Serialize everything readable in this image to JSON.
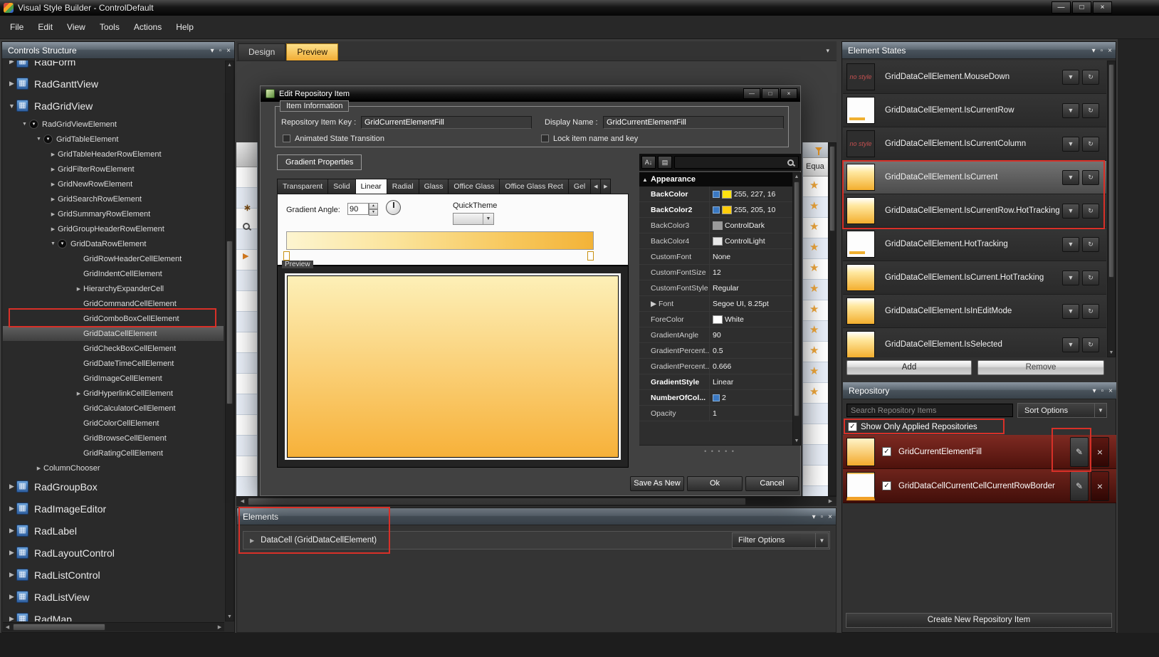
{
  "window": {
    "title": "Visual Style Builder - ControlDefault"
  },
  "menu": [
    "File",
    "Edit",
    "View",
    "Tools",
    "Actions",
    "Help"
  ],
  "controls_structure": {
    "title": "Controls Structure",
    "tree": [
      {
        "label": "RadForm",
        "level": 0,
        "top": true,
        "arrow": "right"
      },
      {
        "label": "RadGanttView",
        "level": 0,
        "top": true,
        "arrow": "right"
      },
      {
        "label": "RadGridView",
        "level": 0,
        "top": true,
        "arrow": "down"
      },
      {
        "label": "RadGridViewElement",
        "level": 1,
        "arrow": "down",
        "bullet": true
      },
      {
        "label": "GridTableElement",
        "level": 2,
        "arrow": "down",
        "bullet": true
      },
      {
        "label": "GridTableHeaderRowElement",
        "level": 3,
        "arrow": "right"
      },
      {
        "label": "GridFilterRowElement",
        "level": 3,
        "arrow": "right"
      },
      {
        "label": "GridNewRowElement",
        "level": 3,
        "arrow": "right"
      },
      {
        "label": "GridSearchRowElement",
        "level": 3,
        "arrow": "right"
      },
      {
        "label": "GridSummaryRowElement",
        "level": 3,
        "arrow": "right"
      },
      {
        "label": "GridGroupHeaderRowElement",
        "level": 3,
        "arrow": "right"
      },
      {
        "label": "GridDataRowElement",
        "level": 3,
        "arrow": "down",
        "bullet": true
      },
      {
        "label": "GridRowHeaderCellElement",
        "level": 4
      },
      {
        "label": "GridIndentCellElement",
        "level": 4
      },
      {
        "label": "HierarchyExpanderCell",
        "level": 4,
        "arrow": "right"
      },
      {
        "label": "GridCommandCellElement",
        "level": 4
      },
      {
        "label": "GridComboBoxCellElement",
        "level": 4
      },
      {
        "label": "GridDataCellElement",
        "level": 4,
        "selected": true
      },
      {
        "label": "GridCheckBoxCellElement",
        "level": 4
      },
      {
        "label": "GridDateTimeCellElement",
        "level": 4
      },
      {
        "label": "GridImageCellElement",
        "level": 4
      },
      {
        "label": "GridHyperlinkCellElement",
        "level": 4,
        "arrow": "right"
      },
      {
        "label": "GridCalculatorCellElement",
        "level": 4
      },
      {
        "label": "GridColorCellElement",
        "level": 4
      },
      {
        "label": "GridBrowseCellElement",
        "level": 4
      },
      {
        "label": "GridRatingCellElement",
        "level": 4
      },
      {
        "label": "ColumnChooser",
        "level": 2,
        "arrow": "right"
      },
      {
        "label": "RadGroupBox",
        "level": 0,
        "top": true,
        "arrow": "right"
      },
      {
        "label": "RadImageEditor",
        "level": 0,
        "top": true,
        "arrow": "right"
      },
      {
        "label": "RadLabel",
        "level": 0,
        "top": true,
        "arrow": "right"
      },
      {
        "label": "RadLayoutControl",
        "level": 0,
        "top": true,
        "arrow": "right"
      },
      {
        "label": "RadListControl",
        "level": 0,
        "top": true,
        "arrow": "right"
      },
      {
        "label": "RadListView",
        "level": 0,
        "top": true,
        "arrow": "right"
      },
      {
        "label": "RadMap",
        "level": 0,
        "top": true,
        "arrow": "right"
      }
    ]
  },
  "design_tabs": [
    {
      "label": "Design",
      "active": false
    },
    {
      "label": "Preview",
      "active": true
    }
  ],
  "dialog": {
    "title": "Edit Repository Item",
    "item_information": {
      "group_label": "Item Information",
      "repository_item_key_label": "Repository Item Key :",
      "repository_item_key_value": "GridCurrentElementFill",
      "display_name_label": "Display Name :",
      "display_name_value": "GridCurrentElementFill",
      "animated_checkbox_label": "Animated State Transition",
      "lock_checkbox_label": "Lock item name and key"
    },
    "gradient_tab_label": "Gradient Properties",
    "style_tabs": [
      "Transparent",
      "Solid",
      "Linear",
      "Radial",
      "Glass",
      "Office Glass",
      "Office Glass Rect",
      "Gel"
    ],
    "active_style_tab": "Linear",
    "gradient_angle_label": "Gradient Angle:",
    "gradient_angle_value": "90",
    "quick_theme_label": "QuickTheme",
    "preview_label": "Preview",
    "property_grid": {
      "category": "Appearance",
      "rows": [
        {
          "name": "BackColor",
          "value": "255, 227, 16",
          "swatch": "#ffe310",
          "bold": true,
          "marker": true
        },
        {
          "name": "BackColor2",
          "value": "255, 205, 10",
          "swatch": "#ffcd0a",
          "bold": true,
          "marker": true
        },
        {
          "name": "BackColor3",
          "value": "ControlDark",
          "swatch": "#9a9a9a"
        },
        {
          "name": "BackColor4",
          "value": "ControlLight",
          "swatch": "#e8e8e8"
        },
        {
          "name": "CustomFont",
          "value": "None"
        },
        {
          "name": "CustomFontSize",
          "value": "12"
        },
        {
          "name": "CustomFontStyle",
          "value": "Regular"
        },
        {
          "name": "Font",
          "value": "Segoe UI, 8.25pt",
          "expand": true
        },
        {
          "name": "ForeColor",
          "value": "White",
          "swatch": "#ffffff"
        },
        {
          "name": "GradientAngle",
          "value": "90"
        },
        {
          "name": "GradientPercent...",
          "value": "0.5"
        },
        {
          "name": "GradientPercent...",
          "value": "0.666"
        },
        {
          "name": "GradientStyle",
          "value": "Linear",
          "bold": true
        },
        {
          "name": "NumberOfCol...",
          "value": "2",
          "bold": true,
          "marker": true
        },
        {
          "name": "Opacity",
          "value": "1"
        }
      ]
    },
    "buttons": {
      "save_as_new": "Save As New",
      "ok": "Ok",
      "cancel": "Cancel"
    }
  },
  "elements_panel": {
    "title": "Elements",
    "item": "DataCell (GridDataCellElement)",
    "filter_button": "Filter Options"
  },
  "element_states": {
    "title": "Element States",
    "no_style_text": "no style",
    "items": [
      {
        "label": "GridDataCellElement.MouseDown",
        "icon": "no-style"
      },
      {
        "label": "GridDataCellElement.IsCurrentRow",
        "icon": "row"
      },
      {
        "label": "GridDataCellElement.IsCurrentColumn",
        "icon": "no-style"
      },
      {
        "label": "GridDataCellElement.IsCurrent",
        "icon": "fill",
        "selected": true
      },
      {
        "label": "GridDataCellElement.IsCurrentRow.HotTracking",
        "icon": "fill"
      },
      {
        "label": "GridDataCellElement.HotTracking",
        "icon": "row"
      },
      {
        "label": "GridDataCellElement.IsCurrent.HotTracking",
        "icon": "fill"
      },
      {
        "label": "GridDataCellElement.IsInEditMode",
        "icon": "fill"
      },
      {
        "label": "GridDataCellElement.IsSelected",
        "icon": "fill"
      }
    ],
    "add_button": "Add",
    "remove_button": "Remove"
  },
  "repository": {
    "title": "Repository",
    "search_placeholder": "Search Repository Items",
    "sort_options": "Sort Options",
    "show_only_label": "Show Only Applied Repositories",
    "show_only_checked": true,
    "items": [
      {
        "label": "GridCurrentElementFill",
        "checked": true,
        "swatch": "gradient"
      },
      {
        "label": "GridDataCellCurrentCellCurrentRowBorder",
        "checked": true,
        "swatch": "border"
      }
    ],
    "create_button": "Create New Repository Item"
  },
  "preview_grid": {
    "column_header": "Equa",
    "star_rows": 11
  },
  "colors": {
    "accent_yellow": "#f2ae36",
    "annotation_red": "#d83028",
    "repository_row_red": "#6e241c"
  }
}
